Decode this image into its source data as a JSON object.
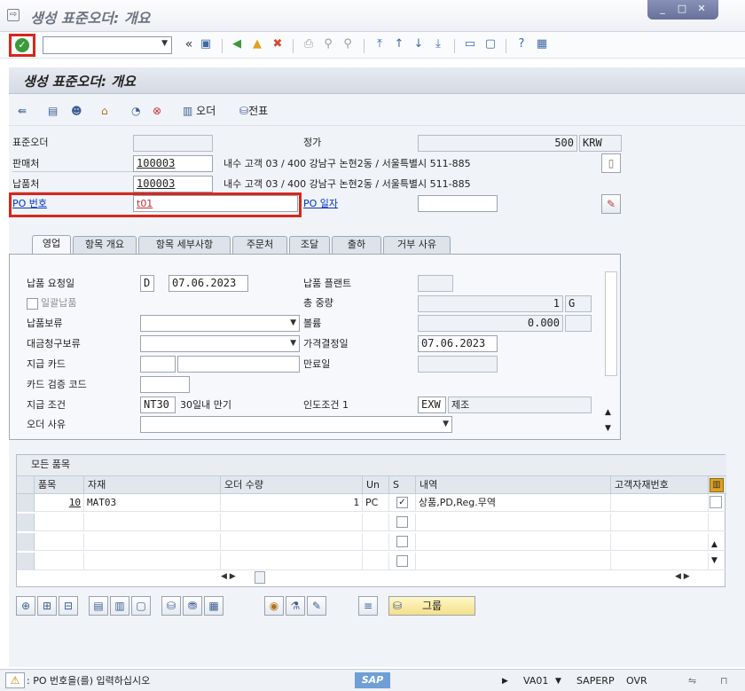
{
  "window": {
    "title": "생성 표준오더: 개요",
    "min": "_",
    "max": "□",
    "close": "✕"
  },
  "toolbar": {
    "command_value": "",
    "back_arrows": "«"
  },
  "screen_title": "생성 표준오더: 개요",
  "app_toolbar": {
    "order_label": "오더",
    "voucher_label": "전표"
  },
  "header": {
    "std_order_label": "표준오더",
    "std_order_value": "",
    "net_label": "정가",
    "net_value": "500",
    "currency": "KRW",
    "sold_to_label": "판매처",
    "sold_to_value": "100003",
    "sold_to_desc": "내수 고객 03 / 400 강남구 논현2동 / 서울특별시 511-885",
    "ship_to_label": "납품처",
    "ship_to_value": "100003",
    "ship_to_desc": "내수 고객 03 / 400 강남구 논현2동 / 서울특별시 511-885",
    "po_no_label": "PO 번호",
    "po_no_value": "t01",
    "po_date_label": "PO 일자",
    "po_date_value": ""
  },
  "tabs": [
    "영업",
    "항목 개요",
    "항목 세부사항",
    "주문처",
    "조달",
    "출하",
    "거부 사유"
  ],
  "sales": {
    "req_deliv_label": "납품 요청일",
    "req_deliv_type": "D",
    "req_deliv_date": "07.06.2023",
    "deliv_plant_label": "납품 플랜트",
    "deliv_plant_value": "",
    "complete_label": "일괄납품",
    "total_weight_label": "총 중량",
    "total_weight_value": "1",
    "weight_unit": "G",
    "deliv_block_label": "납품보류",
    "deliv_block_value": "",
    "volume_label": "볼륨",
    "volume_value": "0.000",
    "volume_unit": "",
    "billing_block_label": "대금청구보류",
    "billing_block_value": "",
    "pricing_date_label": "가격결정일",
    "pricing_date_value": "07.06.2023",
    "pay_card_label": "지급 카드",
    "pay_card_1": "",
    "pay_card_2": "",
    "expiry_label": "만료일",
    "expiry_value": "",
    "card_verif_label": "카드 검증 코드",
    "card_verif_value": "",
    "pay_terms_label": "지급 조건",
    "pay_terms_value": "NT30",
    "pay_terms_desc": "30일내 만기",
    "incoterms_label": "인도조건 1",
    "incoterms_value": "EXW",
    "incoterms_desc": "제조",
    "order_reason_label": "오더 사유",
    "order_reason_value": ""
  },
  "items": {
    "title": "모든 품목",
    "columns": [
      "품목",
      "자재",
      "오더 수량",
      "Un",
      "S",
      "내역",
      "고객자재번호"
    ],
    "rows": [
      {
        "item": "10",
        "material": "MAT03",
        "qty": "1",
        "unit": "PC",
        "s": true,
        "desc": "상품,PD,Reg.무역",
        "cust_mat": ""
      },
      {
        "item": "",
        "material": "",
        "qty": "",
        "unit": "",
        "s": false,
        "desc": "",
        "cust_mat": ""
      },
      {
        "item": "",
        "material": "",
        "qty": "",
        "unit": "",
        "s": false,
        "desc": "",
        "cust_mat": ""
      },
      {
        "item": "",
        "material": "",
        "qty": "",
        "unit": "",
        "s": false,
        "desc": "",
        "cust_mat": ""
      }
    ]
  },
  "buttons": {
    "group_label": "그룹"
  },
  "status": {
    "message": ": PO 번호을(를) 입력하십시오",
    "brand": "SAP",
    "tcode": "VA01",
    "system": "SAPERP",
    "mode": "OVR"
  },
  "colors": {
    "highlight": "#d9261c",
    "link": "#0033cc"
  }
}
